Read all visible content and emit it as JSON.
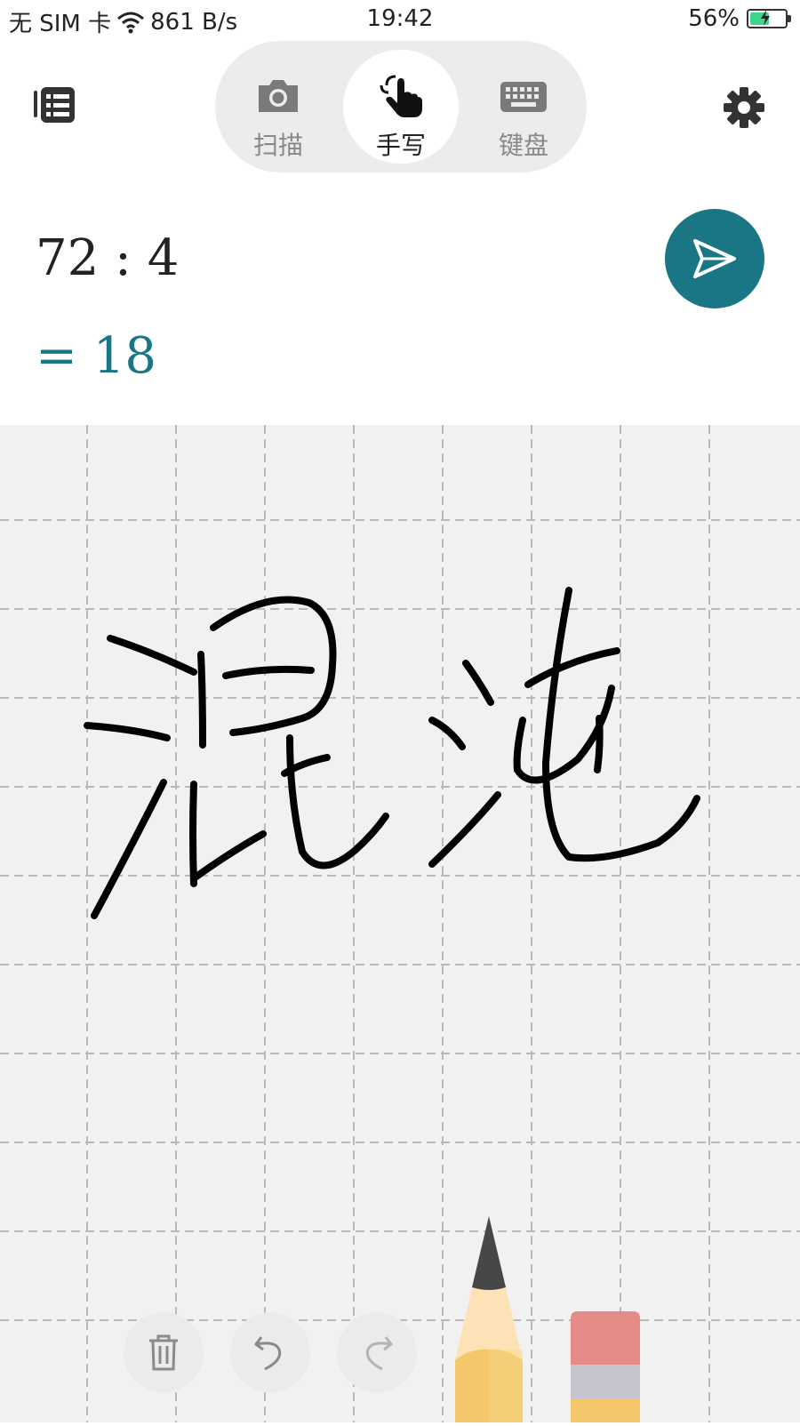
{
  "status_bar": {
    "carrier": "无 SIM 卡",
    "speed": "861 B/s",
    "time": "19:42",
    "battery_percent": "56%",
    "battery_level": 0.56
  },
  "topbar": {
    "modes": [
      {
        "label": "扫描",
        "icon": "camera-icon"
      },
      {
        "label": "手写",
        "icon": "handwriting-hand-icon"
      },
      {
        "label": "键盘",
        "icon": "keyboard-icon"
      }
    ],
    "active_mode": "手写",
    "left_icon": "history-list-icon",
    "right_icon": "gear-icon"
  },
  "calc": {
    "expression": "72 : 4",
    "result": "= 18"
  },
  "colors": {
    "accent": "#1a7585",
    "canvas": "#f1f1f1",
    "grid": "#b9b9b9"
  },
  "canvas": {
    "handwriting": "混沌"
  },
  "tools": {
    "delete_icon": "trash-icon",
    "undo_icon": "undo-icon",
    "redo_icon": "redo-icon",
    "pen_icon": "pencil-icon",
    "eraser_icon": "eraser-icon"
  }
}
